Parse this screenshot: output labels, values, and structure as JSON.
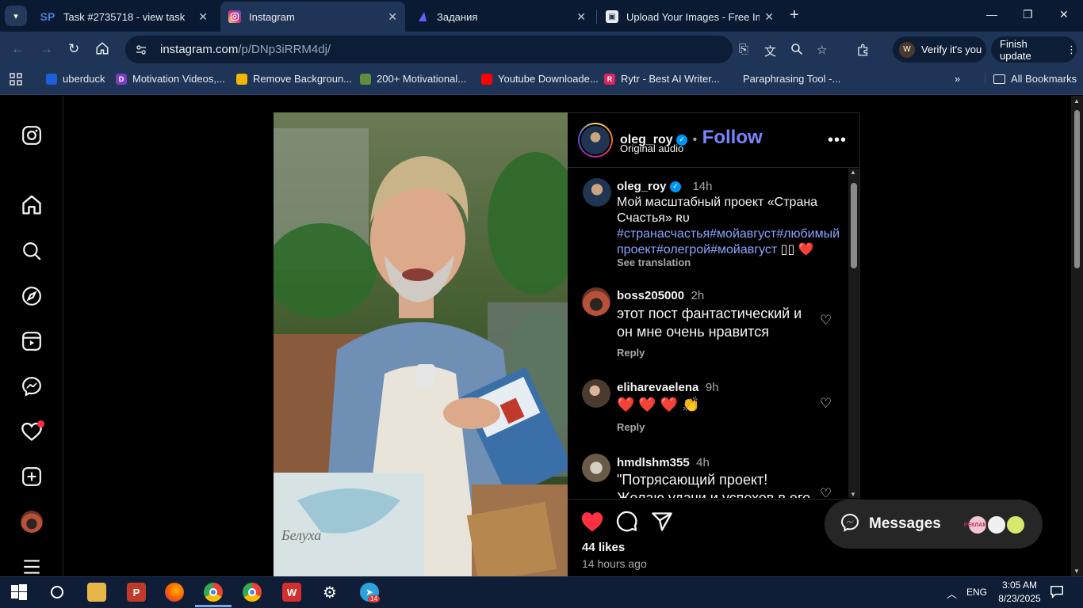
{
  "browser": {
    "tabs": [
      {
        "title": "Task #2735718 - view task",
        "favicon": "SP",
        "active": false
      },
      {
        "title": "Instagram",
        "favicon": "instagram-icon",
        "active": true
      },
      {
        "title": "Задания",
        "favicon": "triangle-icon",
        "active": false
      },
      {
        "title": "Upload Your Images - Free Ima",
        "favicon": "image-icon",
        "active": false
      }
    ],
    "url_host": "instagram.com",
    "url_path": "/p/DNp3iRRM4dj/",
    "profile_label": "Verify it's you",
    "profile_initial": "W",
    "update_label": "Finish update",
    "bookmarks": [
      {
        "label": "uberduck",
        "icon": "duck-icon",
        "color": "#1d5fd6"
      },
      {
        "label": "Motivation Videos,...",
        "icon": "D",
        "color": "#7a3fbf"
      },
      {
        "label": "Remove Backgroun...",
        "icon": "removebg-icon",
        "color": "#f2b705"
      },
      {
        "label": "200+ Motivational...",
        "icon": "shopify-icon",
        "color": "#5e8e3e"
      },
      {
        "label": "Youtube Downloade...",
        "icon": "youtube-icon",
        "color": "#ff0000"
      },
      {
        "label": "Rytr - Best AI Writer...",
        "icon": "R",
        "color": "#e0245e"
      },
      {
        "label": "Paraphrasing Tool -...",
        "icon": "pen-icon",
        "color": "#1e3557"
      }
    ],
    "all_bookmarks_label": "All Bookmarks"
  },
  "post": {
    "author": "oleg_roy",
    "subtitle": "Original audio",
    "follow_label": "Follow",
    "media_text": "Белуха",
    "caption": {
      "username": "oleg_roy",
      "time": "14h",
      "text": "Мой масштабный проект «Страна Счастья» ʀᴜ",
      "hashtags": "#странасчастья#мойавгуст#любимый проект#олегрой#мойавгуст",
      "hashtags_suffix": " ▯▯ ❤️",
      "see_translation": "See translation"
    },
    "comments": [
      {
        "username": "boss205000",
        "time": "2h",
        "text": "этот пост фантастический и он мне очень нравится",
        "reply": "Reply"
      },
      {
        "username": "eliharevaelena",
        "time": "9h",
        "text": "❤️ ❤️ ❤️ 👏",
        "reply": "Reply"
      },
      {
        "username": "hmdlshm355",
        "time": "4h",
        "text": "\"Потрясающий проект! Желаю удачи и успехов в его"
      }
    ],
    "likes": "44 likes",
    "posted_ago": "14 hours ago"
  },
  "messages": {
    "label": "Messages",
    "avatar_texts": [
      "РЕКЛАМА",
      "",
      ""
    ]
  },
  "taskbar": {
    "lang": "ENG",
    "time": "3:05 AM",
    "date": "8/23/2025",
    "telegram_badge": "14"
  }
}
